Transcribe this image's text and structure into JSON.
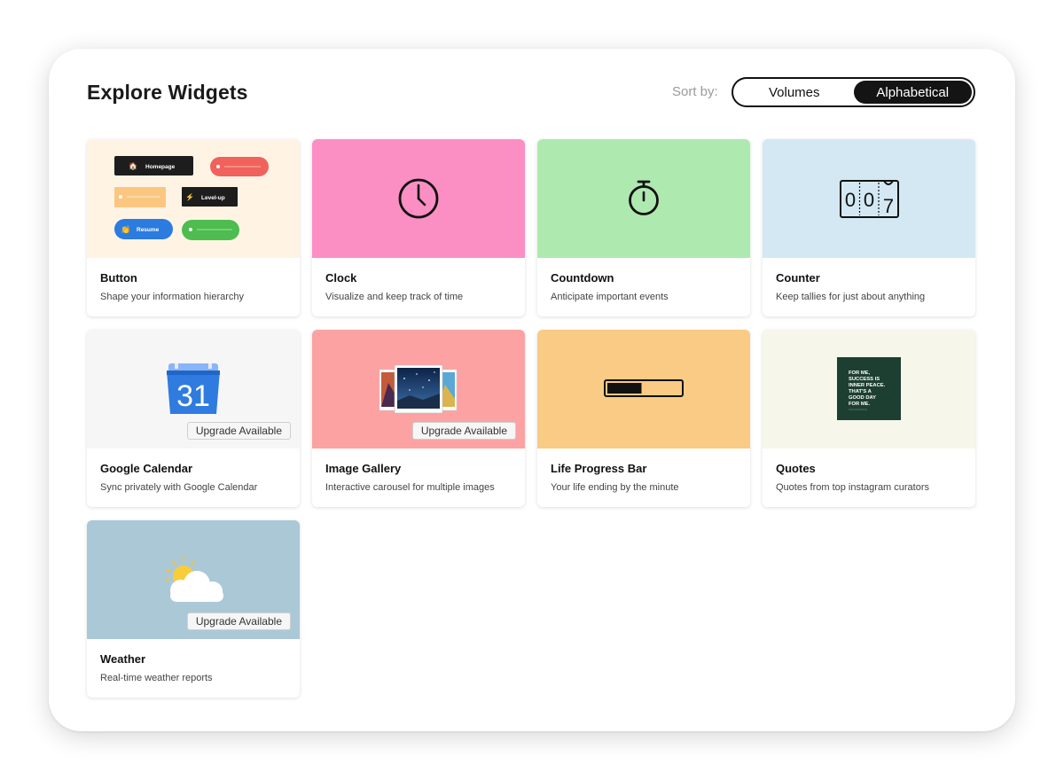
{
  "header": {
    "title": "Explore Widgets",
    "sort_label": "Sort by:",
    "sort_options": [
      "Volumes",
      "Alphabetical"
    ],
    "selected_sort": "Alphabetical"
  },
  "widgets": [
    {
      "name": "Button",
      "description": "Shape your information hierarchy",
      "color": "#fff4e4",
      "icon": "button-collage-icon"
    },
    {
      "name": "Clock",
      "description": "Visualize and keep track of time",
      "color": "#fb8fc4",
      "icon": "clock-icon"
    },
    {
      "name": "Countdown",
      "description": "Anticipate important events",
      "color": "#aee9b0",
      "icon": "stopwatch-icon"
    },
    {
      "name": "Counter",
      "description": "Keep tallies for just about anything",
      "color": "#d3e8f3",
      "icon": "counter-icon",
      "digits": "007"
    },
    {
      "name": "Google Calendar",
      "description": "Sync privately with Google Calendar",
      "color": "#f6f6f6",
      "icon": "google-calendar-icon",
      "icon_text": "31",
      "badge": "Upgrade Available"
    },
    {
      "name": "Image Gallery",
      "description": "Interactive carousel for multiple images",
      "color": "#fca2a3",
      "icon": "photo-stack-icon",
      "badge": "Upgrade Available"
    },
    {
      "name": "Life Progress Bar",
      "description": "Your life ending by the minute",
      "color": "#f9cb84",
      "icon": "progress-bar-icon",
      "progress": 0.47
    },
    {
      "name": "Quotes",
      "description": "Quotes from top instagram curators",
      "color": "#f6f6ea",
      "icon": "quote-card-icon",
      "quote_lines": [
        "FOR ME,",
        "SUCCESS IS",
        "INNER PEACE.",
        "THAT'S A",
        "GOOD DAY",
        "FOR ME."
      ]
    },
    {
      "name": "Weather",
      "description": "Real-time weather reports",
      "color": "#abc8d7",
      "icon": "sun-cloud-icon",
      "badge": "Upgrade Available"
    }
  ],
  "button_preview": {
    "labels": [
      "Homepage",
      "Level-up",
      "Resume"
    ],
    "colors": {
      "dark": "#1d1d1d",
      "red": "#f0625b",
      "orange": "#fbc780",
      "blue": "#2c7be0",
      "green": "#4cbd4e"
    }
  }
}
